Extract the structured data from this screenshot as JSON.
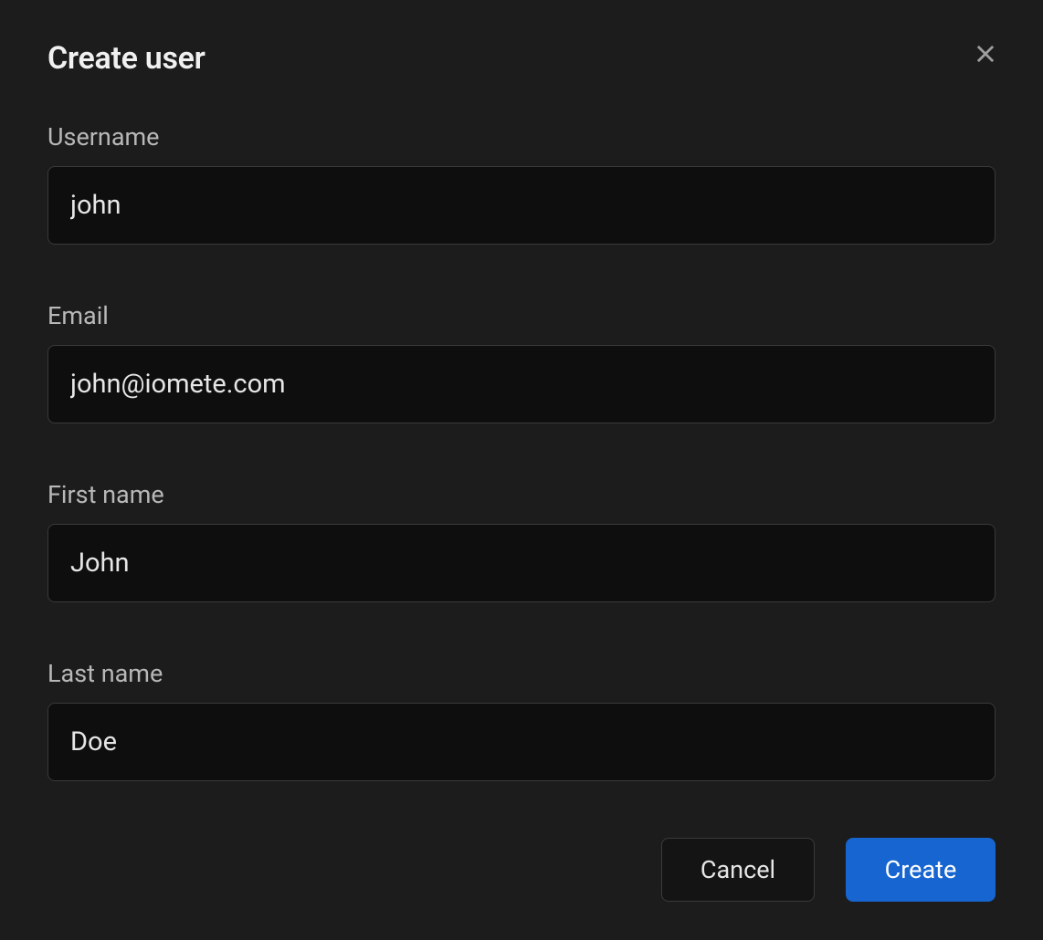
{
  "modal": {
    "title": "Create user",
    "fields": {
      "username": {
        "label": "Username",
        "value": "john"
      },
      "email": {
        "label": "Email",
        "value": "john@iomete.com"
      },
      "first_name": {
        "label": "First name",
        "value": "John"
      },
      "last_name": {
        "label": "Last name",
        "value": "Doe"
      }
    },
    "actions": {
      "cancel": "Cancel",
      "create": "Create"
    }
  }
}
